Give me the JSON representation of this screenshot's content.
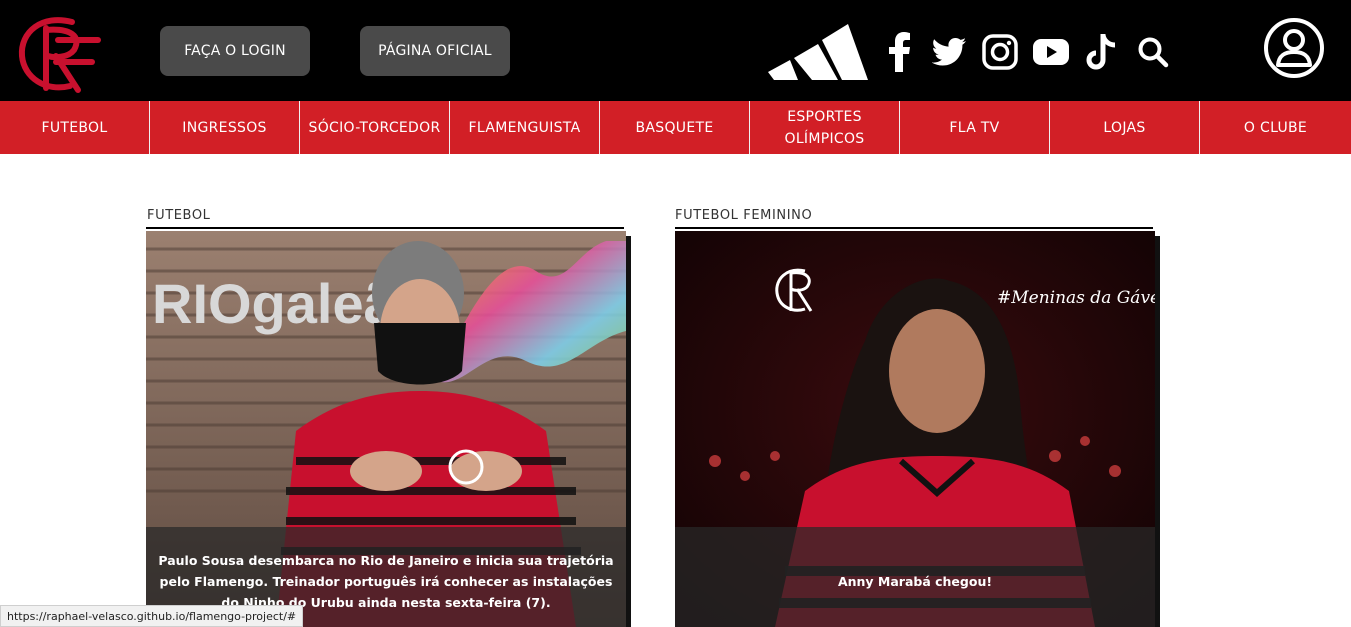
{
  "header": {
    "login_label": "FAÇA O LOGIN",
    "official_label": "PÁGINA OFICIAL",
    "brand_icon": "adidas-logo",
    "social_icons": [
      "facebook-icon",
      "twitter-icon",
      "instagram-icon",
      "youtube-icon",
      "tiktok-icon",
      "search-icon"
    ],
    "user_icon": "user-icon"
  },
  "nav": {
    "items": [
      {
        "label": "FUTEBOL"
      },
      {
        "label": "INGRESSOS"
      },
      {
        "label": "SÓCIO-TORCEDOR"
      },
      {
        "label": "FLAMENGUISTA"
      },
      {
        "label": "BASQUETE"
      },
      {
        "label": "ESPORTES OLÍMPICOS"
      },
      {
        "label": "FLA TV"
      },
      {
        "label": "LOJAS"
      },
      {
        "label": "O CLUBE"
      }
    ]
  },
  "cards": [
    {
      "category": "FUTEBOL",
      "caption": "Paulo Sousa desembarca no Rio de Janeiro e inicia sua trajetória pelo Flamengo. Treinador português irá conhecer as instalações do Ninho do Urubu ainda nesta sexta-feira (7).",
      "photo_text": "RIOgaleão"
    },
    {
      "category": "FUTEBOL FEMININO",
      "caption": "Anny Marabá chegou!",
      "photo_text": "#Meninas da Gávea"
    }
  ],
  "status_url": "https://raphael-velasco.github.io/flamengo-project/#",
  "colors": {
    "header_bg": "#000000",
    "nav_bg": "#d21f26",
    "button_bg": "#4a4a4a",
    "logo_red": "#c8102e"
  }
}
